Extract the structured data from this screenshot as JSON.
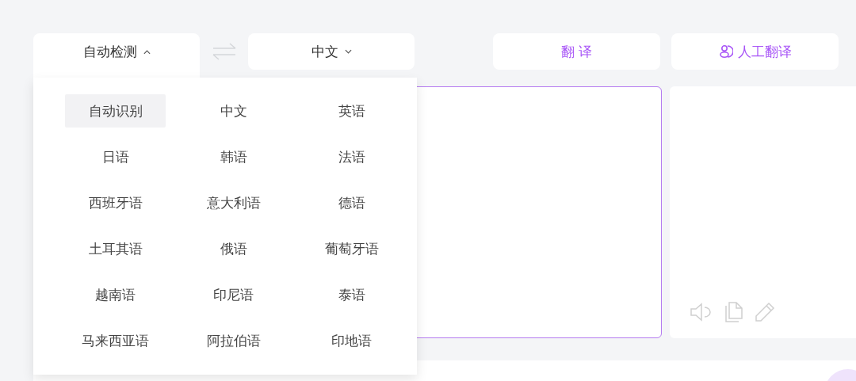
{
  "source_language": {
    "label": "自动检测",
    "expanded": true
  },
  "target_language": {
    "label": "中文",
    "expanded": false
  },
  "translate_button": {
    "label": "翻 译"
  },
  "human_translate_button": {
    "label": "人工翻译"
  },
  "language_menu": {
    "items": [
      {
        "label": "自动识别",
        "selected": true
      },
      {
        "label": "中文",
        "selected": false
      },
      {
        "label": "英语",
        "selected": false
      },
      {
        "label": "日语",
        "selected": false
      },
      {
        "label": "韩语",
        "selected": false
      },
      {
        "label": "法语",
        "selected": false
      },
      {
        "label": "西班牙语",
        "selected": false
      },
      {
        "label": "意大利语",
        "selected": false
      },
      {
        "label": "德语",
        "selected": false
      },
      {
        "label": "土耳其语",
        "selected": false
      },
      {
        "label": "俄语",
        "selected": false
      },
      {
        "label": "葡萄牙语",
        "selected": false
      },
      {
        "label": "越南语",
        "selected": false
      },
      {
        "label": "印尼语",
        "selected": false
      },
      {
        "label": "泰语",
        "selected": false
      },
      {
        "label": "马来西亚语",
        "selected": false
      },
      {
        "label": "阿拉伯语",
        "selected": false
      },
      {
        "label": "印地语",
        "selected": false
      }
    ]
  }
}
